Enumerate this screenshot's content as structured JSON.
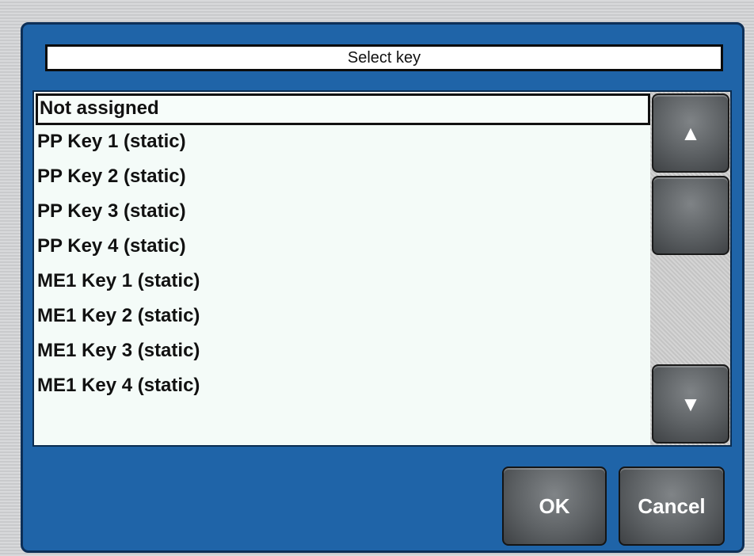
{
  "dialog": {
    "title": "Select key"
  },
  "list": {
    "items": [
      {
        "label": "Not assigned",
        "selected": true
      },
      {
        "label": "PP Key 1 (static)",
        "selected": false
      },
      {
        "label": "PP Key 2 (static)",
        "selected": false
      },
      {
        "label": "PP Key 3 (static)",
        "selected": false
      },
      {
        "label": "PP Key 4 (static)",
        "selected": false
      },
      {
        "label": "ME1 Key 1 (static)",
        "selected": false
      },
      {
        "label": "ME1 Key 2 (static)",
        "selected": false
      },
      {
        "label": "ME1 Key 3 (static)",
        "selected": false
      },
      {
        "label": "ME1 Key 4 (static)",
        "selected": false
      }
    ]
  },
  "scrollbar": {
    "up_icon": "▲",
    "down_icon": "▼",
    "up_icon_name": "arrow-up-icon",
    "down_icon_name": "arrow-down-icon"
  },
  "buttons": {
    "ok_label": "OK",
    "cancel_label": "Cancel"
  },
  "colors": {
    "dialog_bg": "#1f64a8",
    "list_bg": "#f4fbf8",
    "button_face": "#5c6063"
  }
}
